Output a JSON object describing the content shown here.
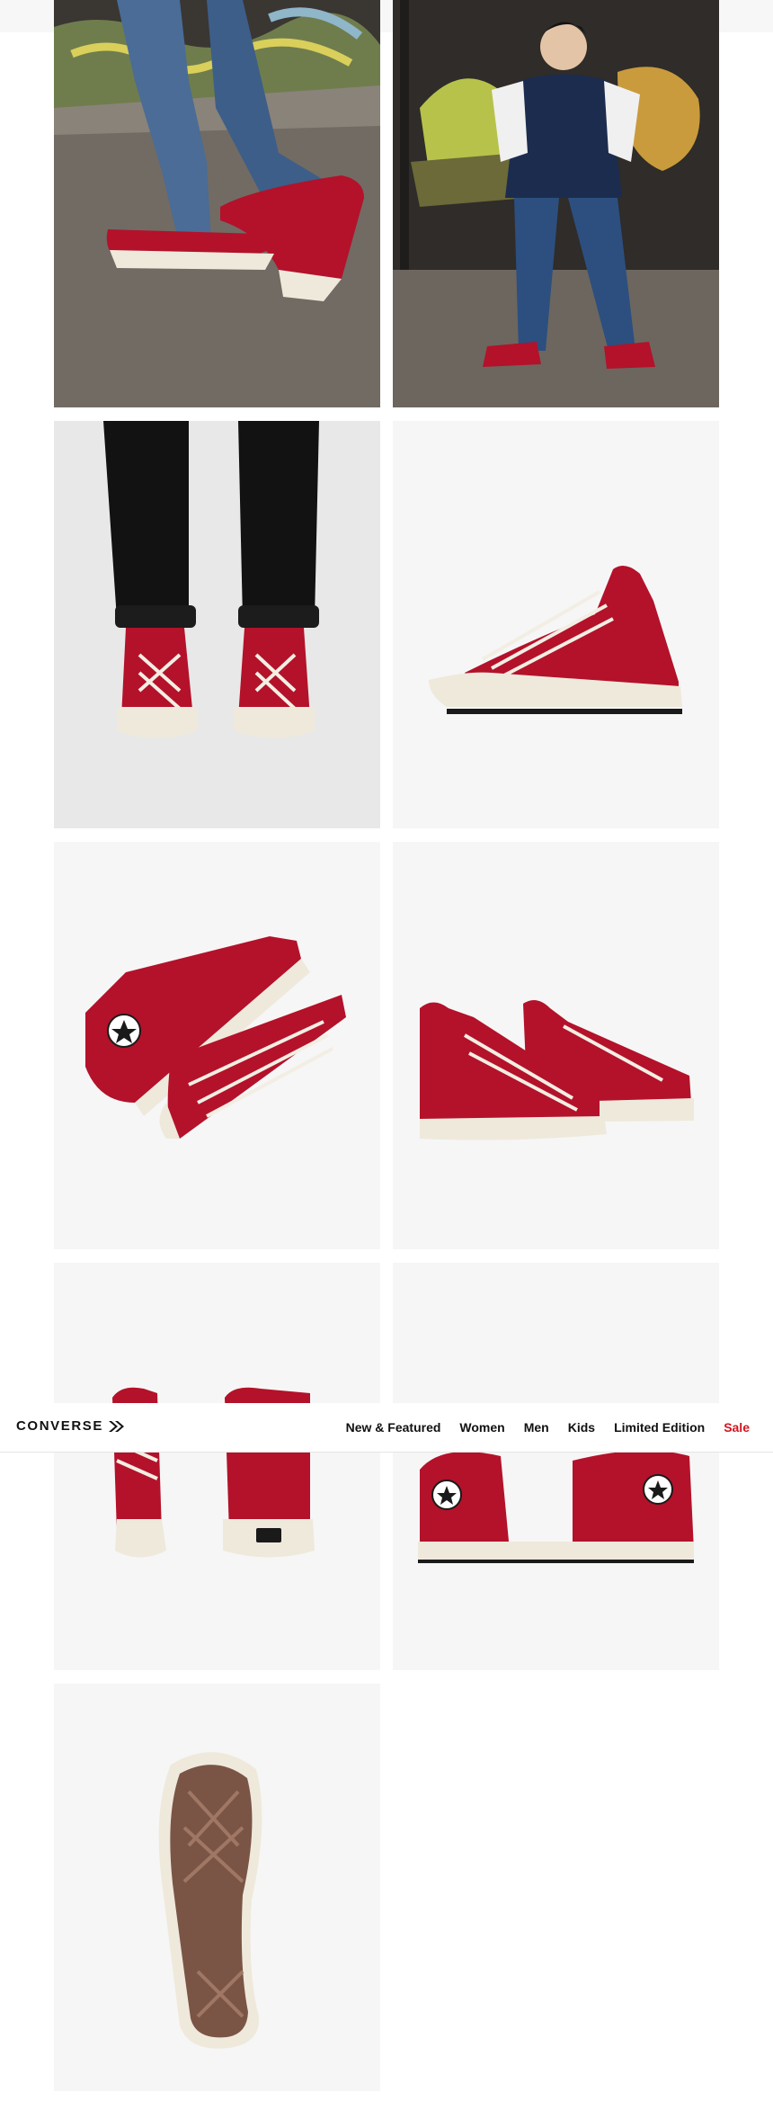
{
  "brand": {
    "name": "CONVERSE",
    "logo_icon": "chevron-arrow-icon"
  },
  "nav": {
    "items": [
      {
        "label": "New & Featured"
      },
      {
        "label": "Women"
      },
      {
        "label": "Men"
      },
      {
        "label": "Kids"
      },
      {
        "label": "Limited Edition"
      },
      {
        "label": "Sale",
        "color": "#d3151d"
      }
    ]
  },
  "gallery": {
    "images": [
      {
        "name": "street-feet-photo"
      },
      {
        "name": "model-street-photo"
      },
      {
        "name": "pair-front-on-feet-photo"
      },
      {
        "name": "side-view-photo"
      },
      {
        "name": "top-down-pair-photo"
      },
      {
        "name": "pair-angle-photo"
      },
      {
        "name": "back-view-photo"
      },
      {
        "name": "inner-side-pair-photo"
      },
      {
        "name": "outsole-photo"
      }
    ]
  },
  "colors": {
    "shoe_red": "#b3122a",
    "sole_cream": "#efe9dc",
    "background": "#f6f6f6"
  }
}
